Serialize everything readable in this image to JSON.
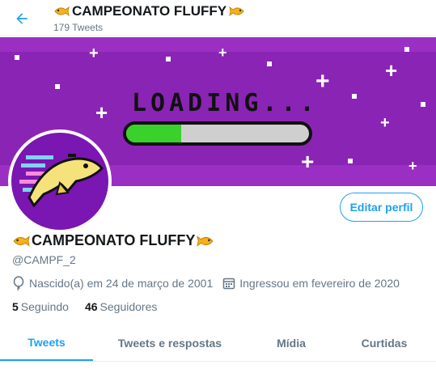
{
  "header": {
    "title": "CAMPEONATO FLUFFY",
    "tweet_count": "179 Tweets",
    "back_icon": "arrow-left-icon"
  },
  "banner": {
    "loading_text": "LOADING...",
    "loading_progress": 0.3,
    "background_color": "#9b2fc4",
    "progress_color": "#3ad12c"
  },
  "profile": {
    "name": "CAMPEONATO FLUFFY",
    "handle": "@CAMPF_2",
    "birth": "Nascido(a) em 24 de março de 2001",
    "joined": "Ingressou em fevereiro de 2020",
    "edit_button": "Editar perfil",
    "emoji_icon": "fish-icon",
    "accent_color": "#1da1f2"
  },
  "counts": {
    "following_count": "5",
    "following_label": "Seguindo",
    "followers_count": "46",
    "followers_label": "Seguidores"
  },
  "tabs": [
    {
      "label": "Tweets",
      "active": true
    },
    {
      "label": "Tweets e respostas",
      "active": false
    },
    {
      "label": "Mídia",
      "active": false
    },
    {
      "label": "Curtidas",
      "active": false
    }
  ]
}
